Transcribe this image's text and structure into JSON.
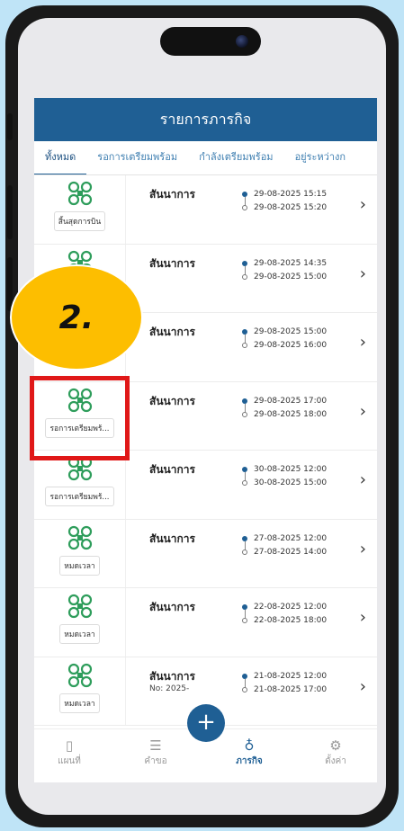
{
  "header": {
    "title": "รายการภารกิจ"
  },
  "tabs": [
    {
      "label": "ทั้งหมด",
      "active": true
    },
    {
      "label": "รอการเตรียมพร้อม",
      "active": false
    },
    {
      "label": "กำลังเตรียมพร้อม",
      "active": false
    },
    {
      "label": "อยู่ระหว่างก",
      "active": false
    }
  ],
  "missions": [
    {
      "title": "สันนาการ",
      "status": "สิ้นสุดการบิน",
      "start": "29-08-2025 15:15",
      "end": "29-08-2025 15:20"
    },
    {
      "title": "สันนาการ",
      "status": "",
      "start": "29-08-2025 14:35",
      "end": "29-08-2025 15:00"
    },
    {
      "title": "สันนาการ",
      "status": "",
      "start": "29-08-2025 15:00",
      "end": "29-08-2025 16:00"
    },
    {
      "title": "สันนาการ",
      "status": "รอการเตรียมพร้...",
      "start": "29-08-2025 17:00",
      "end": "29-08-2025 18:00"
    },
    {
      "title": "สันนาการ",
      "status": "รอการเตรียมพร้...",
      "start": "30-08-2025 12:00",
      "end": "30-08-2025 15:00"
    },
    {
      "title": "สันนาการ",
      "status": "หมดเวลา",
      "start": "27-08-2025 12:00",
      "end": "27-08-2025 14:00"
    },
    {
      "title": "สันนาการ",
      "status": "หมดเวลา",
      "start": "22-08-2025 12:00",
      "end": "22-08-2025 18:00"
    },
    {
      "title": "สันนาการ",
      "sub": "No: 2025-",
      "status": "หมดเวลา",
      "start": "21-08-2025 12:00",
      "end": "21-08-2025 17:00"
    }
  ],
  "nav": {
    "map": {
      "label": "แผนที่",
      "icon": "map-icon"
    },
    "requests": {
      "label": "คำขอ",
      "icon": "list-icon"
    },
    "missions": {
      "label": "ภารกิจ",
      "icon": "mission-icon"
    },
    "settings": {
      "label": "ตั้งค่า",
      "icon": "gear-icon"
    },
    "add": {
      "label": "+",
      "icon": "plus-icon"
    }
  },
  "annotation": {
    "step_label": "2."
  },
  "colors": {
    "primary": "#1f5f94",
    "drone": "#2e9d5b",
    "badge": "#fdbe00",
    "highlight": "#e01818"
  }
}
